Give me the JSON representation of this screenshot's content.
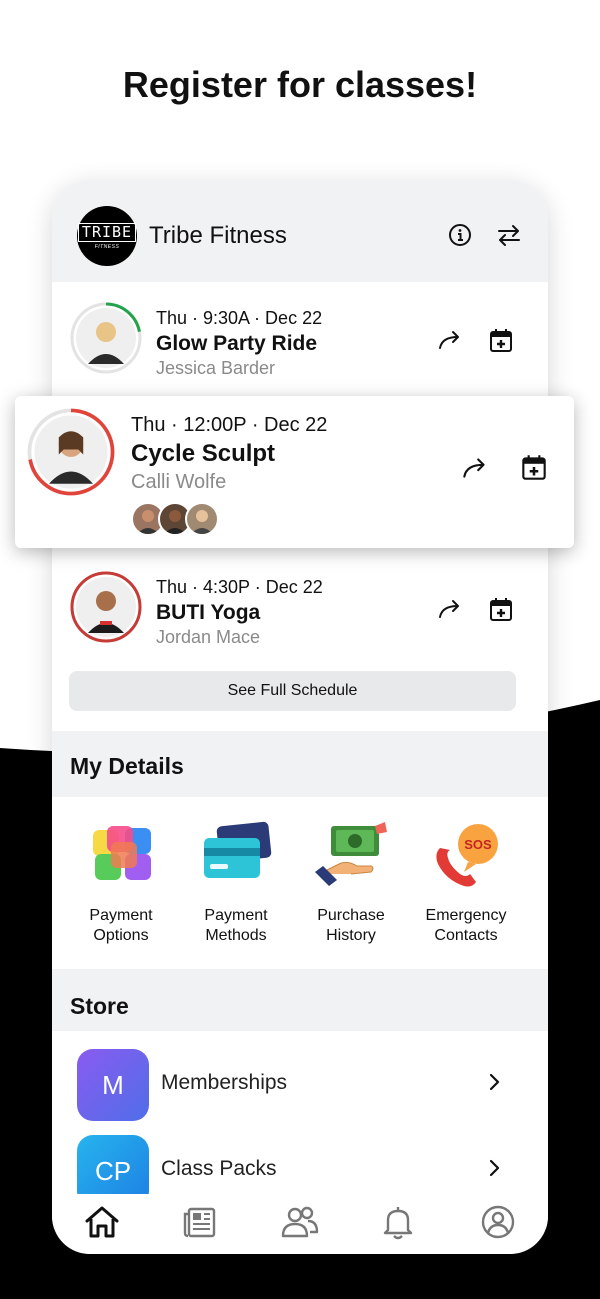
{
  "headline": "Register for classes!",
  "app": {
    "logo_text": "TRIBE",
    "logo_subtext": "FITNESS",
    "title": "Tribe Fitness"
  },
  "header_actions": [
    "info-icon",
    "switch-arrows-icon"
  ],
  "classes": [
    {
      "time": "Thu · 9:30A · Dec 22",
      "name": "Glow Party Ride",
      "instructor": "Jessica Barder",
      "ring_color": "#22a34a",
      "ring_fraction": 0.22
    },
    {
      "time": "Thu · 12:00P · Dec 22",
      "name": "Cycle Sculpt",
      "instructor": "Calli Wolfe",
      "ring_color": "#e0443a",
      "ring_fraction": 0.72
    },
    {
      "time": "Thu · 4:30P · Dec 22",
      "name": "BUTI Yoga",
      "instructor": "Jordan Mace",
      "ring_color": "#c63b35",
      "ring_fraction": 1.0
    }
  ],
  "see_full_schedule": "See Full Schedule",
  "my_details": {
    "title": "My Details",
    "items": [
      {
        "label": "Payment\nOptions",
        "icon": "payment-options-icon"
      },
      {
        "label": "Payment\nMethods",
        "icon": "credit-cards-icon"
      },
      {
        "label": "Purchase\nHistory",
        "icon": "cash-hand-icon"
      },
      {
        "label": "Emergency\nContacts",
        "icon": "sos-phone-icon"
      }
    ]
  },
  "store": {
    "title": "Store",
    "items": [
      {
        "initials": "M",
        "label": "Memberships",
        "color": "#5e62e6"
      },
      {
        "initials": "CP",
        "label": "Class Packs",
        "color": "#1d9fe6"
      }
    ]
  },
  "tabs": [
    "home-icon",
    "news-icon",
    "people-icon",
    "bell-icon",
    "profile-icon"
  ],
  "colors": {
    "background_dark": "#000000",
    "header_bg": "#f1f2f4",
    "button_bg": "#e8e9eb",
    "muted_text": "#8a8a8a"
  }
}
